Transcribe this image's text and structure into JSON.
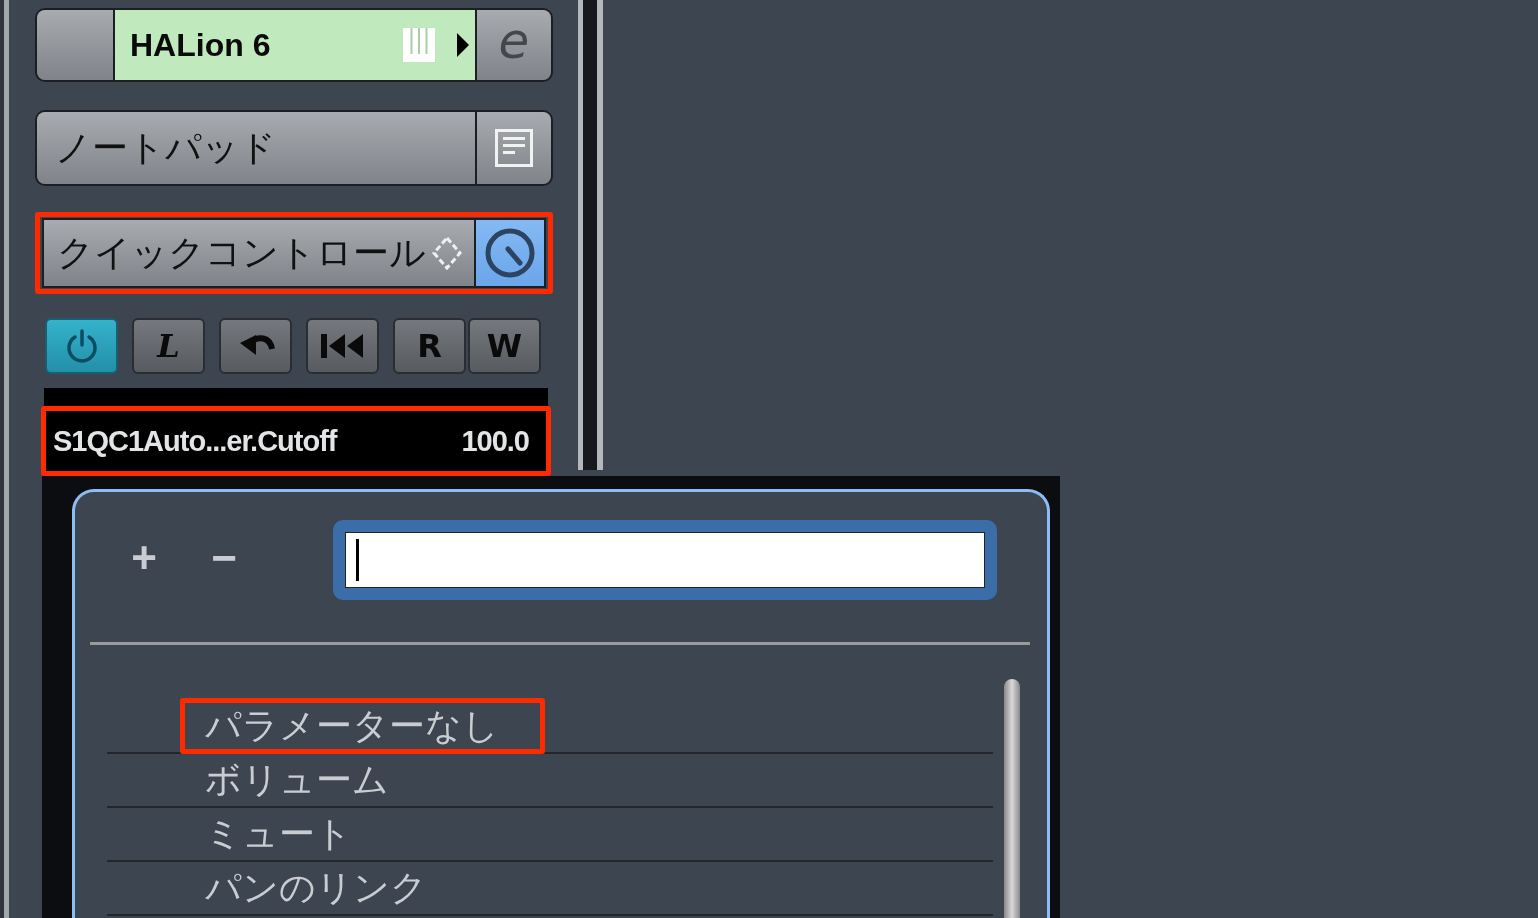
{
  "instrument": {
    "name": "HALion 6",
    "edit_label": "e"
  },
  "notepad": {
    "label": "ノートパッド"
  },
  "quick_controls": {
    "label": "クイックコントロール",
    "active": true,
    "highlighted": true
  },
  "toolbar": [
    {
      "kind": "power",
      "on": true
    },
    {
      "kind": "letter",
      "label": "L",
      "on": false
    },
    {
      "kind": "undo",
      "on": false
    },
    {
      "kind": "rewind",
      "on": false
    },
    {
      "kind": "letter",
      "label": "R",
      "on": false
    },
    {
      "kind": "letter",
      "label": "W",
      "on": false
    }
  ],
  "parameter": {
    "name": "S1QC1Auto...er.Cutoff",
    "value": "100.0",
    "highlighted": true
  },
  "popup": {
    "buttons": [
      "+",
      "−"
    ],
    "search": {
      "focused": true
    },
    "items": [
      {
        "label": "パラメーターなし",
        "highlighted": true
      },
      {
        "label": "ボリューム",
        "highlighted": false
      },
      {
        "label": "ミュート",
        "highlighted": false
      },
      {
        "label": "パンのリンク",
        "highlighted": false
      }
    ]
  }
}
